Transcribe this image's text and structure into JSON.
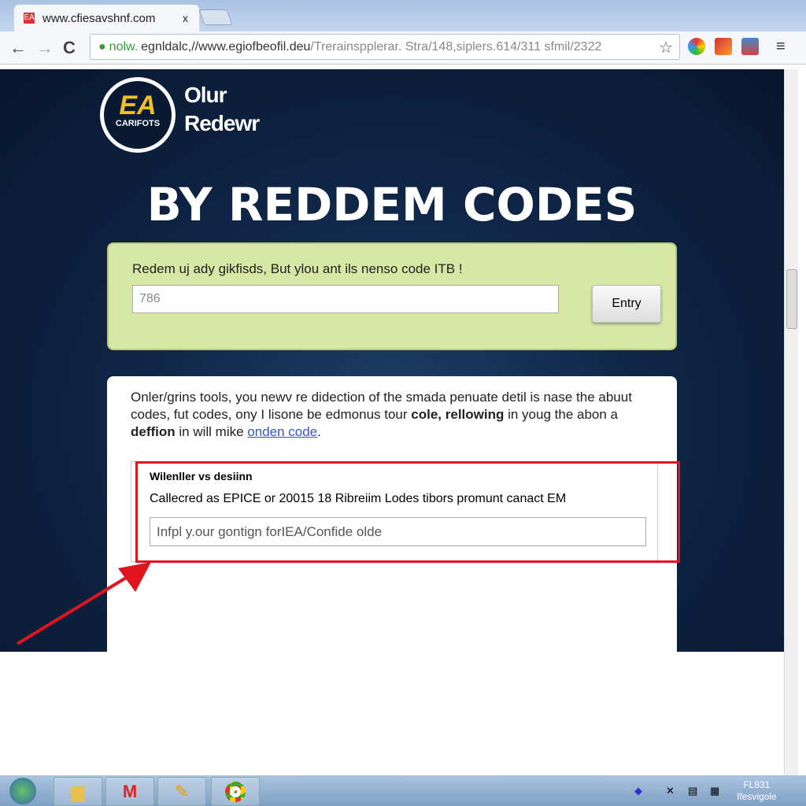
{
  "browser": {
    "tab_title": "www.cfiesavshnf.com",
    "tab_close": "x",
    "url_secure": "nolw.",
    "url_host": "egnldalc,//www.egiofbeofil.deu",
    "url_path": "/Trerainspplerar. Stra/148,siplers.614/311 sfmil/2322",
    "back": "←",
    "forward": "→",
    "reload": "C",
    "star": "☆",
    "menu": "≡"
  },
  "page": {
    "logo": {
      "mark": "EA",
      "sub": "CARIFOTS"
    },
    "brand_line1": "Olur",
    "brand_line2": "Redewr",
    "title": "BY REDDEM CODES",
    "redeem_box": {
      "label": "Redem uj ady gikfisds, But ylou ant ils nenso code ITB !",
      "input_value": "786",
      "button": "Entry"
    },
    "info": {
      "p1": "Onler/grins tools, you newv re didection of the smada penuate detil is nase the abuut codes, fut codes, ony I lisone be edmonus tour ",
      "b1": "cole, rellowing",
      "p2": " in youg the abon a ",
      "b2": "deffion",
      "p3": " in will mike ",
      "link": "onden code",
      "p4": ".",
      "section_heading": "Wilenller vs desiinn",
      "section_desc": "Callecred as EPICE or 20015 18 Ribreiim Lodes tibors promunt canact EM",
      "code_input_value": "Infpl y.our gontign forIEA/Confide olde"
    }
  },
  "colors": {
    "accent_red": "#e0141e",
    "green_box": "#d6e7a6",
    "page_bg": "#0f2647"
  },
  "taskbar": {
    "clock_line1": "FL831",
    "clock_line2": "Ifesvigole",
    "apps": [
      "windows-explorer",
      "gmail",
      "pencil",
      "chrome"
    ]
  }
}
